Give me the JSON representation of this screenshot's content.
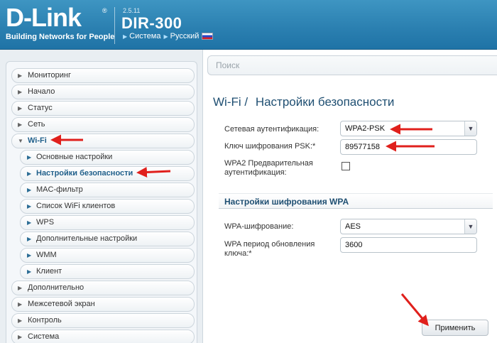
{
  "header": {
    "logo": "D-Link",
    "logo_reg": "®",
    "tagline": "Building Networks for People",
    "firmware": "2.5.11",
    "model": "DIR-300",
    "nav_system": "Система",
    "nav_language": "Русский"
  },
  "sidebar": {
    "items": [
      {
        "label": "Мониторинг"
      },
      {
        "label": "Начало"
      },
      {
        "label": "Статус"
      },
      {
        "label": "Сеть"
      },
      {
        "label": "Wi-Fi"
      },
      {
        "label": "Основные настройки"
      },
      {
        "label": "Настройки безопасности"
      },
      {
        "label": "MAC-фильтр"
      },
      {
        "label": "Список WiFi клиентов"
      },
      {
        "label": "WPS"
      },
      {
        "label": "Дополнительные настройки"
      },
      {
        "label": "WMM"
      },
      {
        "label": "Клиент"
      },
      {
        "label": "Дополнительно"
      },
      {
        "label": "Межсетевой экран"
      },
      {
        "label": "Контроль"
      },
      {
        "label": "Система"
      }
    ]
  },
  "main": {
    "search_placeholder": "Поиск",
    "title_section": "Wi-Fi /",
    "title_page": "Настройки безопасности",
    "auth_label": "Сетевая аутентификация:",
    "auth_value": "WPA2-PSK",
    "psk_label": "Ключ шифрования PSK:*",
    "psk_value": "89577158",
    "wpa2_preauth_label_line1": "WPA2 Предварительная",
    "wpa2_preauth_label_line2": "аутентификация:",
    "wpa2_preauth_checked": false,
    "wpa_section_title": "Настройки шифрования WPA",
    "wpa_enc_label": "WPA-шифрование:",
    "wpa_enc_value": "AES",
    "wpa_period_label_line1": "WPA период обновления",
    "wpa_period_label_line2": "ключа:*",
    "wpa_period_value": "3600",
    "apply_label": "Применить"
  },
  "colors": {
    "header_blue": "#2a7fb0",
    "title_blue": "#1f4f72",
    "annotation_red": "#e0201c"
  }
}
